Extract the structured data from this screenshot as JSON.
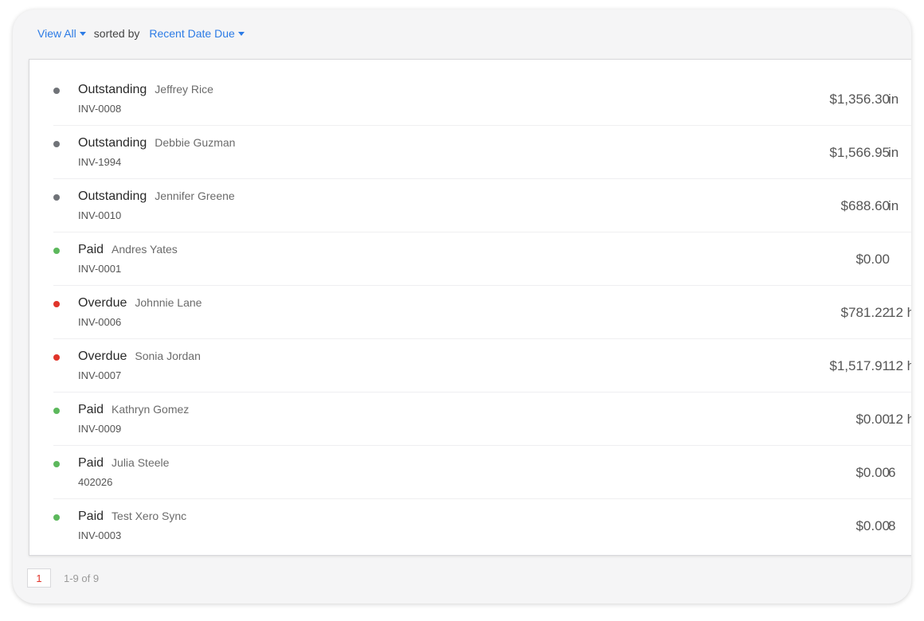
{
  "filter": {
    "view_label": "View All",
    "sorted_by_label": "sorted by",
    "sort_label": "Recent Date Due"
  },
  "colors": {
    "Outstanding": "#707378",
    "Paid": "#5cb85c",
    "Overdue": "#e0342a",
    "link": "#2c7be5"
  },
  "invoices": [
    {
      "status": "Outstanding",
      "name": "Jeffrey Rice",
      "number": "INV-0008",
      "amount": "$1,356.30",
      "due": "in"
    },
    {
      "status": "Outstanding",
      "name": "Debbie Guzman",
      "number": "INV-1994",
      "amount": "$1,566.95",
      "due": "in"
    },
    {
      "status": "Outstanding",
      "name": "Jennifer Greene",
      "number": "INV-0010",
      "amount": "$688.60",
      "due": "in"
    },
    {
      "status": "Paid",
      "name": "Andres Yates",
      "number": "INV-0001",
      "amount": "$0.00",
      "due": ""
    },
    {
      "status": "Overdue",
      "name": "Johnnie Lane",
      "number": "INV-0006",
      "amount": "$781.22",
      "due": "12 h"
    },
    {
      "status": "Overdue",
      "name": "Sonia Jordan",
      "number": "INV-0007",
      "amount": "$1,517.91",
      "due": "12 h"
    },
    {
      "status": "Paid",
      "name": "Kathryn Gomez",
      "number": "INV-0009",
      "amount": "$0.00",
      "due": "12 h"
    },
    {
      "status": "Paid",
      "name": "Julia Steele",
      "number": "402026",
      "amount": "$0.00",
      "due": "6"
    },
    {
      "status": "Paid",
      "name": "Test Xero Sync",
      "number": "INV-0003",
      "amount": "$0.00",
      "due": "8"
    }
  ],
  "pagination": {
    "current_page": "1",
    "range": "1-9 of 9"
  }
}
